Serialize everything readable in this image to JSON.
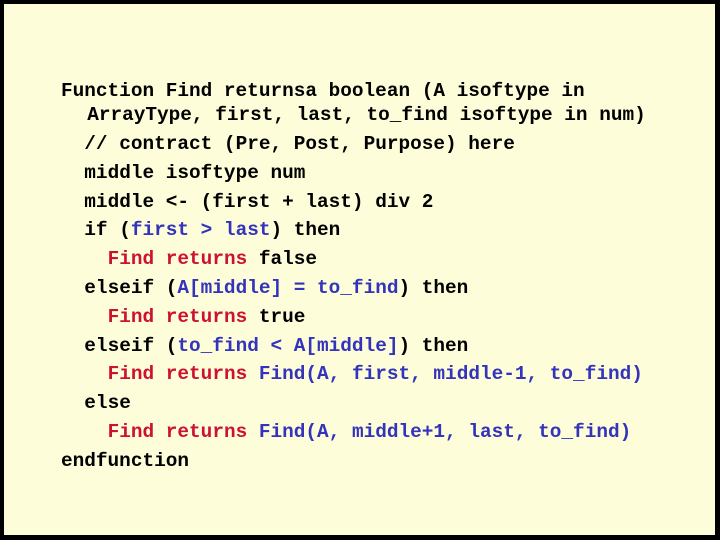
{
  "slide": {
    "colors": {
      "background": "#fdfdd9",
      "border": "#000000",
      "text": "#000000",
      "keyword_red": "#cc1133",
      "expression_blue": "#3333bb"
    },
    "code_lines": [
      {
        "indent": 0,
        "segments": [
          {
            "text": "Function Find returnsa boolean (A isoftype in",
            "style": "plain"
          }
        ]
      },
      {
        "indent": 2.25,
        "segments": [
          {
            "text": "ArrayType, first, last, to_find isoftype in num)",
            "style": "plain"
          }
        ]
      },
      {
        "indent": 2,
        "segments": [
          {
            "text": "// contract (Pre, Post, Purpose) here",
            "style": "plain"
          }
        ]
      },
      {
        "indent": 2,
        "segments": [
          {
            "text": "middle isoftype num",
            "style": "plain"
          }
        ]
      },
      {
        "indent": 2,
        "segments": [
          {
            "text": "middle <- (first + last) div 2",
            "style": "plain"
          }
        ]
      },
      {
        "indent": 2,
        "segments": [
          {
            "text": "if (",
            "style": "plain"
          },
          {
            "text": "first > last",
            "style": "blue"
          },
          {
            "text": ") then",
            "style": "plain"
          }
        ]
      },
      {
        "indent": 4,
        "segments": [
          {
            "text": "Find returns",
            "style": "red"
          },
          {
            "text": " false",
            "style": "plain"
          }
        ]
      },
      {
        "indent": 2,
        "segments": [
          {
            "text": "elseif (",
            "style": "plain"
          },
          {
            "text": "A[middle] = to_find",
            "style": "blue"
          },
          {
            "text": ") then",
            "style": "plain"
          }
        ]
      },
      {
        "indent": 4,
        "segments": [
          {
            "text": "Find returns",
            "style": "red"
          },
          {
            "text": " true",
            "style": "plain"
          }
        ]
      },
      {
        "indent": 2,
        "segments": [
          {
            "text": "elseif (",
            "style": "plain"
          },
          {
            "text": "to_find < A[middle]",
            "style": "blue"
          },
          {
            "text": ") then",
            "style": "plain"
          }
        ]
      },
      {
        "indent": 4,
        "segments": [
          {
            "text": "Find returns",
            "style": "red"
          },
          {
            "text": " ",
            "style": "plain"
          },
          {
            "text": "Find(A, first, middle-1, to_find)",
            "style": "blue"
          }
        ]
      },
      {
        "indent": 2,
        "segments": [
          {
            "text": "else",
            "style": "plain"
          }
        ]
      },
      {
        "indent": 4,
        "segments": [
          {
            "text": "Find returns",
            "style": "red"
          },
          {
            "text": " ",
            "style": "plain"
          },
          {
            "text": "Find(A, middle+1, last, to_find)",
            "style": "blue"
          }
        ]
      },
      {
        "indent": 0,
        "segments": [
          {
            "text": "endfunction",
            "style": "plain"
          }
        ]
      }
    ]
  }
}
